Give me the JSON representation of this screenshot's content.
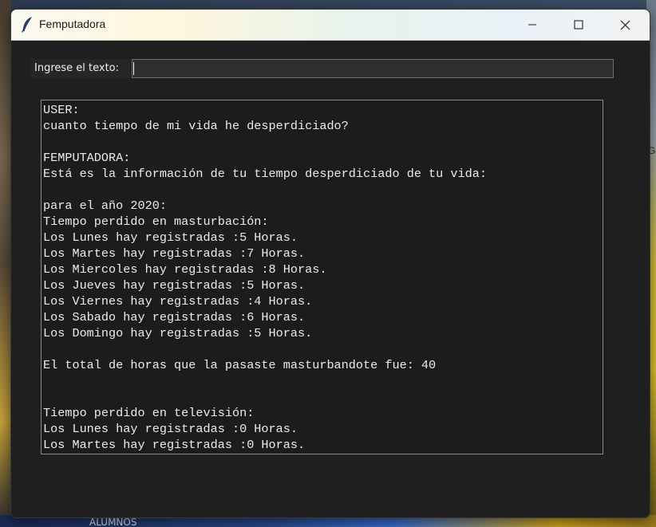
{
  "background": {
    "taskbar_text": "ALUMNOS",
    "side_letter": "G"
  },
  "window": {
    "title": "Femputadora",
    "controls": {
      "minimize_icon": "minimize-icon",
      "maximize_icon": "maximize-icon",
      "close_icon": "close-icon"
    }
  },
  "form": {
    "label": "Ingrese el texto:",
    "input_value": "",
    "input_placeholder": ""
  },
  "output": {
    "lines": [
      "USER:",
      "cuanto tiempo de mi vida he desperdiciado?",
      "",
      "FEMPUTADORA:",
      "Está es la información de tu tiempo desperdiciado de tu vida:",
      "",
      "para el año 2020:",
      "Tiempo perdido en masturbación:",
      "Los Lunes hay registradas :5 Horas.",
      "Los Martes hay registradas :7 Horas.",
      "Los Miercoles hay registradas :8 Horas.",
      "Los Jueves hay registradas :5 Horas.",
      "Los Viernes hay registradas :4 Horas.",
      "Los Sabado hay registradas :6 Horas.",
      "Los Domingo hay registradas :5 Horas.",
      "",
      "El total de horas que la pasaste masturbandote fue: 40",
      "",
      "",
      "Tiempo perdido en televisión:",
      "Los Lunes hay registradas :0 Horas.",
      "Los Martes hay registradas :0 Horas."
    ]
  },
  "colors": {
    "window_bg": "#1f1f1f",
    "text": "#ececec",
    "titlebar_text": "#1a1a1a"
  }
}
